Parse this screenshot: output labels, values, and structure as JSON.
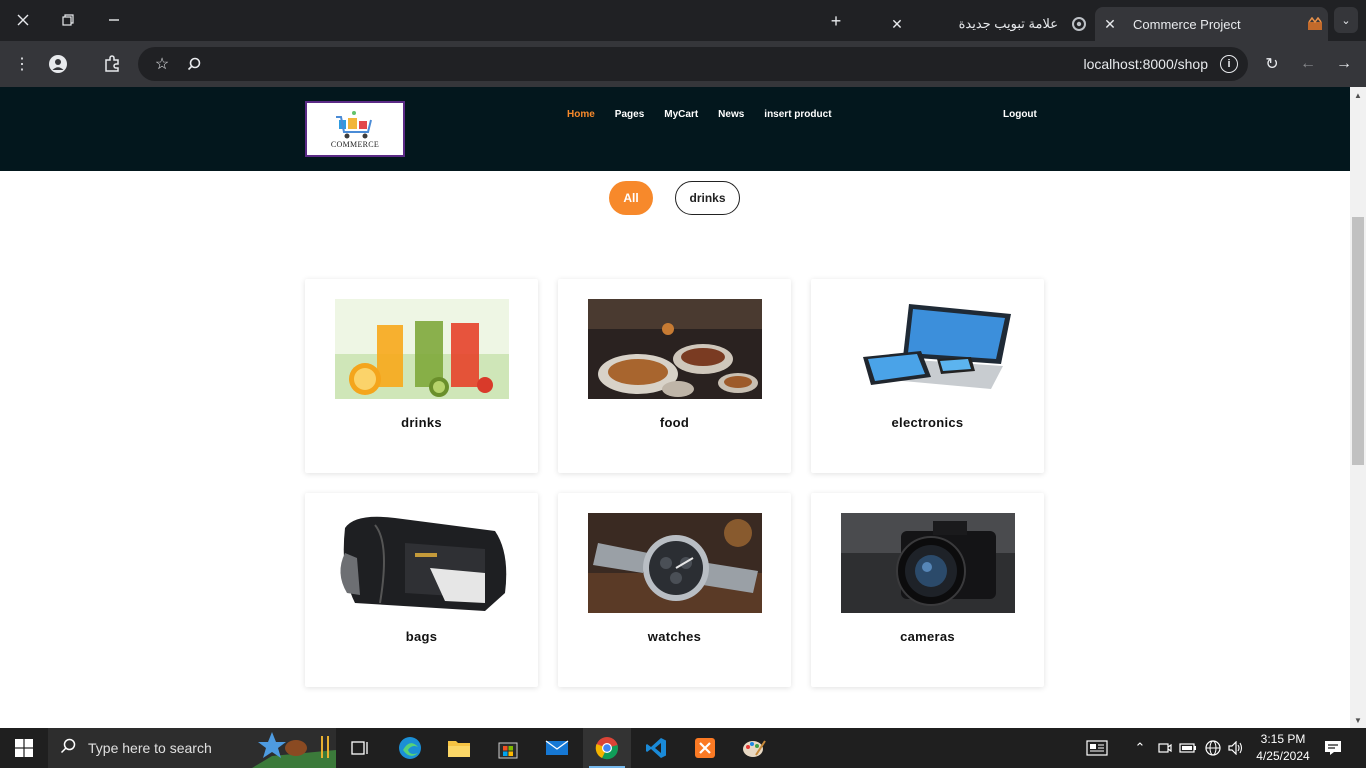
{
  "browser": {
    "tabs": [
      {
        "title": "علامة تبويب جديدة",
        "active": false
      },
      {
        "title": "Commerce Project",
        "active": true
      }
    ],
    "url": "localhost:8000/shop",
    "window_controls": [
      "close-icon",
      "restore-icon",
      "minimize-icon"
    ]
  },
  "site": {
    "logo_text": "COMMERCE",
    "nav": [
      {
        "label": "Home",
        "active": true
      },
      {
        "label": "Pages",
        "active": false
      },
      {
        "label": "MyCart",
        "active": false
      },
      {
        "label": "News",
        "active": false
      },
      {
        "label": "insert product",
        "active": false
      }
    ],
    "logout_label": "Logout",
    "filters": [
      {
        "label": "All",
        "active": true
      },
      {
        "label": "drinks",
        "active": false
      }
    ],
    "categories": [
      {
        "label": "drinks"
      },
      {
        "label": "food"
      },
      {
        "label": "electronics"
      },
      {
        "label": "bags"
      },
      {
        "label": "watches"
      },
      {
        "label": "cameras"
      }
    ],
    "accent_color": "#f7892b",
    "header_color": "#03171d"
  },
  "taskbar": {
    "search_placeholder": "Type here to search",
    "time": "3:15 PM",
    "date": "4/25/2024"
  }
}
